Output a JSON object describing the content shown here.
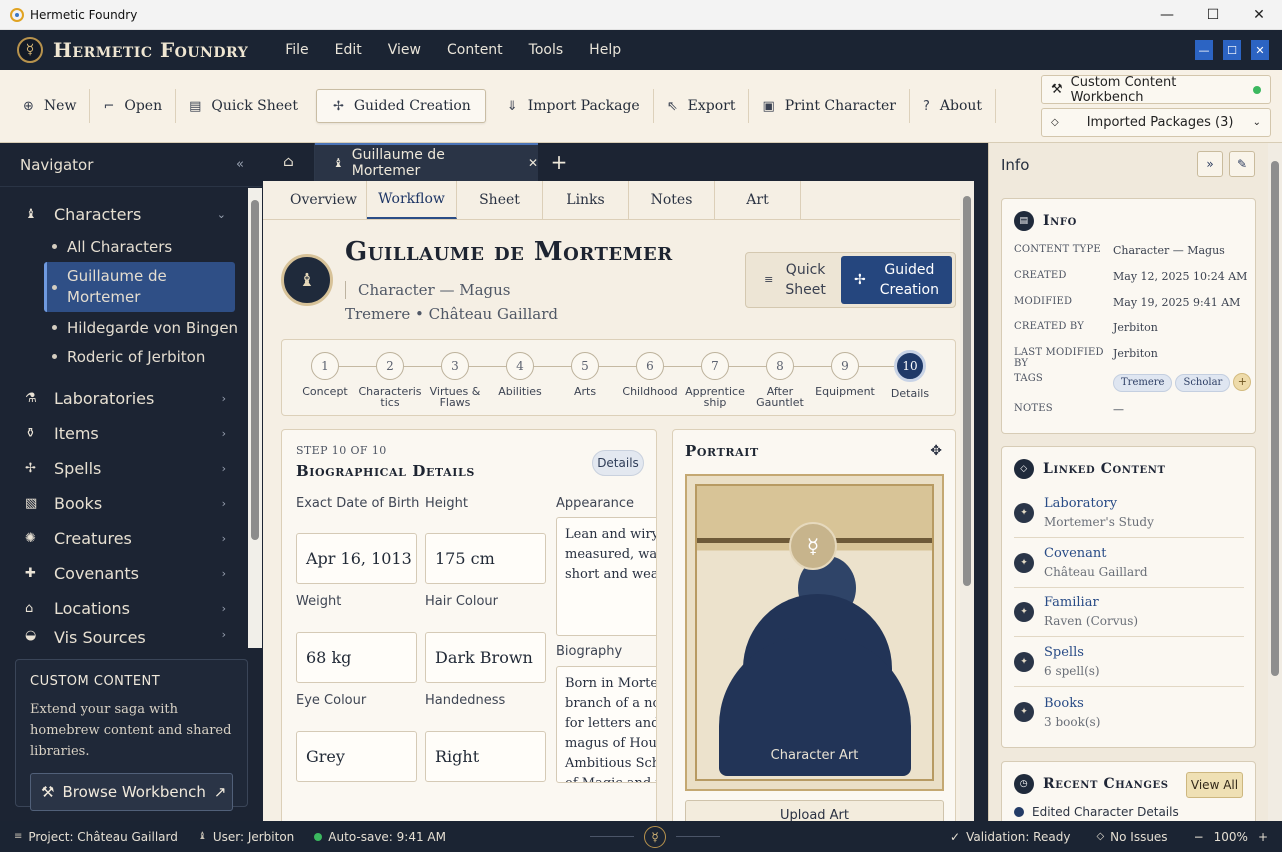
{
  "os": {
    "title": "Hermetic Foundry",
    "controls": [
      "—",
      "☐",
      "✕"
    ]
  },
  "app": {
    "brand": "Hermetic Foundry",
    "logo_glyph": "☿",
    "menu": [
      "File",
      "Edit",
      "View",
      "Content",
      "Tools",
      "Help"
    ],
    "window_buttons": [
      "—",
      "☐",
      "✕"
    ]
  },
  "toolbar": {
    "items": [
      {
        "icon": "plus-circle-icon",
        "glyph": "⊕",
        "label": "New"
      },
      {
        "icon": "open-icon",
        "glyph": "⌐",
        "label": "Open"
      },
      {
        "icon": "sheet-icon",
        "glyph": "▤",
        "label": "Quick Sheet"
      },
      {
        "icon": "guided-icon",
        "glyph": "✢",
        "label": "Guided Creation"
      },
      {
        "icon": "import-icon",
        "glyph": "⇓",
        "label": "Import Package"
      },
      {
        "icon": "export-icon",
        "glyph": "⇖",
        "label": "Export"
      },
      {
        "icon": "print-icon",
        "glyph": "▣",
        "label": "Print Character"
      },
      {
        "icon": "help-icon",
        "glyph": "?",
        "label": "About"
      }
    ],
    "workbench": "Custom Content Workbench",
    "packages": "Imported Packages (3)"
  },
  "navigator": {
    "title": "Navigator",
    "collapse": "«",
    "characters_label": "Characters",
    "characters_children": [
      "All Characters",
      "Hildegarde von Bingen",
      "Roderic of Jerbiton"
    ],
    "active_character_line1": "Guillaume de",
    "active_character_line2": "Mortemer",
    "sections": [
      {
        "icon": "laboratory-icon",
        "glyph": "⚗",
        "label": "Laboratories"
      },
      {
        "icon": "items-icon",
        "glyph": "⚱",
        "label": "Items"
      },
      {
        "icon": "spells-icon",
        "glyph": "✢",
        "label": "Spells"
      },
      {
        "icon": "books-icon",
        "glyph": "▧",
        "label": "Books"
      },
      {
        "icon": "creatures-icon",
        "glyph": "✺",
        "label": "Creatures"
      },
      {
        "icon": "covenants-icon",
        "glyph": "✚",
        "label": "Covenants"
      },
      {
        "icon": "locations-icon",
        "glyph": "⌂",
        "label": "Locations"
      },
      {
        "icon": "vis-icon",
        "glyph": "◒",
        "label": "Vis Sources"
      }
    ],
    "custom_content": {
      "title": "CUSTOM CONTENT",
      "desc": "Extend your saga with homebrew content and shared libraries.",
      "button": "Browse Workbench"
    }
  },
  "tabs": {
    "doc": "Guillaume de Mortemer"
  },
  "subtabs": [
    "Overview",
    "Workflow",
    "Sheet",
    "Links",
    "Notes",
    "Art"
  ],
  "character": {
    "name": "Guillaume de Mortemer",
    "type": "Character — Magus",
    "house_line": "Tremere • Château Gaillard"
  },
  "mode": {
    "quick_line1": "Quick",
    "quick_line2": "Sheet",
    "guided_line1": "Guided",
    "guided_line2": "Creation"
  },
  "steps": [
    {
      "n": "1",
      "l1": "Concept",
      "l2": ""
    },
    {
      "n": "2",
      "l1": "Characteris",
      "l2": "tics"
    },
    {
      "n": "3",
      "l1": "Virtues &",
      "l2": "Flaws"
    },
    {
      "n": "4",
      "l1": "Abilities",
      "l2": ""
    },
    {
      "n": "5",
      "l1": "Arts",
      "l2": ""
    },
    {
      "n": "6",
      "l1": "Childhood",
      "l2": ""
    },
    {
      "n": "7",
      "l1": "Apprentice",
      "l2": "ship"
    },
    {
      "n": "8",
      "l1": "After",
      "l2": "Gauntlet"
    },
    {
      "n": "9",
      "l1": "Equipment",
      "l2": ""
    },
    {
      "n": "10",
      "l1": "Details",
      "l2": ""
    }
  ],
  "current_step": 10,
  "bio": {
    "step": "STEP 10 OF 10",
    "title": "Biographical Details",
    "badge": "Details",
    "fields": {
      "dob_label": "Exact Date of Birth",
      "dob": "Apr 16, 1013",
      "height_label": "Height",
      "height": "175 cm",
      "weight_label": "Weight",
      "weight": "68 kg",
      "hair_label": "Hair Colour",
      "hair": "Dark Brown",
      "eye_label": "Eye Colour",
      "eye": "Grey",
      "hand_label": "Handedness",
      "hand": "Right"
    },
    "appearance_label": "Appearance",
    "appearance_lines": [
      "Lean and wiry b",
      "measured, watc",
      "short and wears"
    ],
    "biography_label": "Biography",
    "biography_lines": [
      "Born in Mortem",
      "branch of a nob",
      "for letters and m",
      "magus of House",
      "Ambitious Scho",
      "of Magic and th"
    ]
  },
  "portrait": {
    "title": "Portrait",
    "caption": "Character Art",
    "upload": "Upload Art",
    "medal": "☿"
  },
  "info": {
    "header": "Info",
    "card_title": "Info",
    "rows": [
      {
        "k": "CONTENT TYPE",
        "v": "Character — Magus"
      },
      {
        "k": "CREATED",
        "v": "May 12, 2025 10:24 AM"
      },
      {
        "k": "MODIFIED",
        "v": "May 19, 2025 9:41 AM"
      },
      {
        "k": "CREATED BY",
        "v": "Jerbiton"
      },
      {
        "k": "LAST MODIFIED BY",
        "v": "Jerbiton"
      }
    ],
    "tags_label": "TAGS",
    "tags": [
      "Tremere",
      "Scholar"
    ],
    "notes_label": "NOTES",
    "notes": "—"
  },
  "linked": {
    "title": "Linked Content",
    "items": [
      {
        "a": "Laboratory",
        "s": "Mortemer's Study"
      },
      {
        "a": "Covenant",
        "s": "Château Gaillard"
      },
      {
        "a": "Familiar",
        "s": "Raven (Corvus)"
      },
      {
        "a": "Spells",
        "s": "6 spell(s)"
      },
      {
        "a": "Books",
        "s": "3 book(s)"
      }
    ]
  },
  "recent": {
    "title": "Recent Changes",
    "view_all": "View All",
    "first": "Edited Character Details"
  },
  "status": {
    "project": "Project: Château Gaillard",
    "user": "User: Jerbiton",
    "autosave": "Auto-save: 9:41 AM",
    "validation": "Validation: Ready",
    "issues": "No Issues",
    "zoom": "100%",
    "zoom_minus": "−",
    "zoom_plus": "+"
  }
}
